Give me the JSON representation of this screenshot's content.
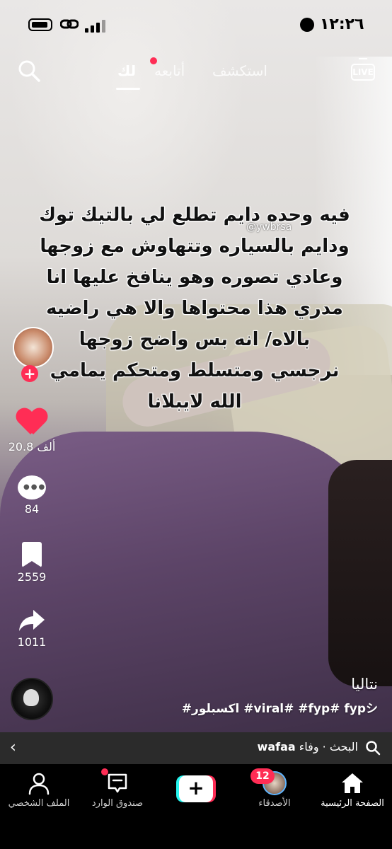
{
  "status_bar": {
    "time": "١٢:٢٦",
    "icons": [
      "globe-icon",
      "battery-icon",
      "link-icon",
      "signal-icon"
    ]
  },
  "top_nav": {
    "tabs": [
      {
        "label": "استكشف",
        "active": false
      },
      {
        "label": "أتابعه",
        "active": false,
        "has_dot": true
      },
      {
        "label": "لك",
        "active": true
      }
    ],
    "live_label": "LIVE",
    "icons": [
      "search-icon",
      "live-icon"
    ]
  },
  "video": {
    "overlay_lines": [
      "فيه وحده دايم تطلع لي بالتيك توك",
      "ودايم بالسياره وتتهاوش مع زوجها",
      "وعادي تصوره وهو ينافخ عليها  انا",
      "مدري هذا محتواها والا هي راضيه",
      "بالاه/ انه بس واضح زوجها",
      "نرجسي ومتسلط ومتحكم يمامي",
      "الله لايبلانا"
    ],
    "watermark": "@ywbrsa"
  },
  "side_actions": {
    "follow_plus": "+",
    "likes": "20.8 ألف",
    "comments": "84",
    "saves": "2559",
    "shares": "1011",
    "icons": [
      "heart-icon",
      "comment-icon",
      "bookmark-icon",
      "share-icon",
      "music-disc-icon"
    ]
  },
  "caption": {
    "username": "نتاليا",
    "hashtags": "#اكسبلور #viral# #fyp# fypシ"
  },
  "search_bar": {
    "query": "wafaa",
    "text": "البحث · وفاء",
    "icons": [
      "chevron-left-icon",
      "search-icon"
    ]
  },
  "bottom_nav": {
    "items": [
      {
        "label": "الصفحة الرئيسية",
        "icon": "home-icon"
      },
      {
        "label": "الأصدقاء",
        "icon": "friends-avatar",
        "badge": "12"
      },
      {
        "label": "",
        "icon": "create-plus-icon",
        "symbol": "+"
      },
      {
        "label": "صندوق الوارد",
        "icon": "inbox-icon",
        "has_dot": true
      },
      {
        "label": "الملف الشخصي",
        "icon": "profile-icon"
      }
    ]
  },
  "colors": {
    "accent_red": "#ff2d55",
    "accent_cyan": "#25f4ee",
    "nav_bg": "#000000",
    "search_bar_bg": "#2b2b2b"
  }
}
